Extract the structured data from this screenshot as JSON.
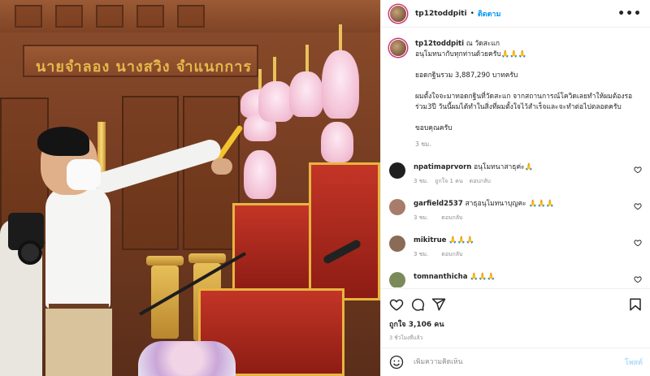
{
  "photo": {
    "plaque_text": "นายจำลอง  นางสวิง  จำแนกการ"
  },
  "header": {
    "username": "tp12toddpiti",
    "separator": "•",
    "follow_label": "ติดตาม",
    "more_label": "•••"
  },
  "caption": {
    "username": "tp12toddpiti",
    "location": "ณ วัดสะแก",
    "line1": "อนุโมทนากับทุกท่านด้วยครับ🙏🙏🙏",
    "total": "ยอดกฐินรวม 3,887,290 บาทครับ",
    "message": "ผมตั้งใจจะมาทอดกฐินที่วัดสะแก จากสถานการณ์โควิดเลยทำให้ผมต้องรอร่วม3ปี วันนี้ผมได้ทำในสิ่งที่ผมตั้งใจไว้สำเร็จและจะทำต่อไปตลอดครับ",
    "thanks": "ขอบคุณครับ",
    "time": "3 ชม."
  },
  "comments": [
    {
      "username": "npatimaprvorn",
      "text": "อนุโมทนาสาธุค่ะ🙏",
      "time": "3 ชม.",
      "likes": "ถูกใจ 1 คน",
      "reply": "ตอบกลับ",
      "avatar_color": "#1f1f1f"
    },
    {
      "username": "garfield2537",
      "text": "สาธุอนุโมทนาบุญคะ 🙏🙏🙏",
      "time": "3 ชม.",
      "likes": "",
      "reply": "ตอบกลับ",
      "avatar_color": "#a77c6a"
    },
    {
      "username": "mikitrue",
      "text": "🙏🙏🙏",
      "time": "3 ชม.",
      "likes": "",
      "reply": "ตอบกลับ",
      "avatar_color": "#8a6b55"
    },
    {
      "username": "tomnanthicha",
      "text": "🙏🙏🙏",
      "time": "",
      "likes": "",
      "reply": "",
      "avatar_color": "#7b8a5a"
    }
  ],
  "actions": {
    "like_icon": "heart-icon",
    "comment_icon": "comment-icon",
    "share_icon": "share-icon",
    "save_icon": "bookmark-icon",
    "likes_text": "ถูกใจ 3,106 คน",
    "post_time": "3 ชั่วโมงที่แล้ว"
  },
  "add_comment": {
    "placeholder": "เพิ่มความคิดเห็น",
    "post_label": "โพสต์"
  },
  "colors": {
    "accent": "#0095f6",
    "muted": "#8e8e8e",
    "text": "#262626"
  }
}
